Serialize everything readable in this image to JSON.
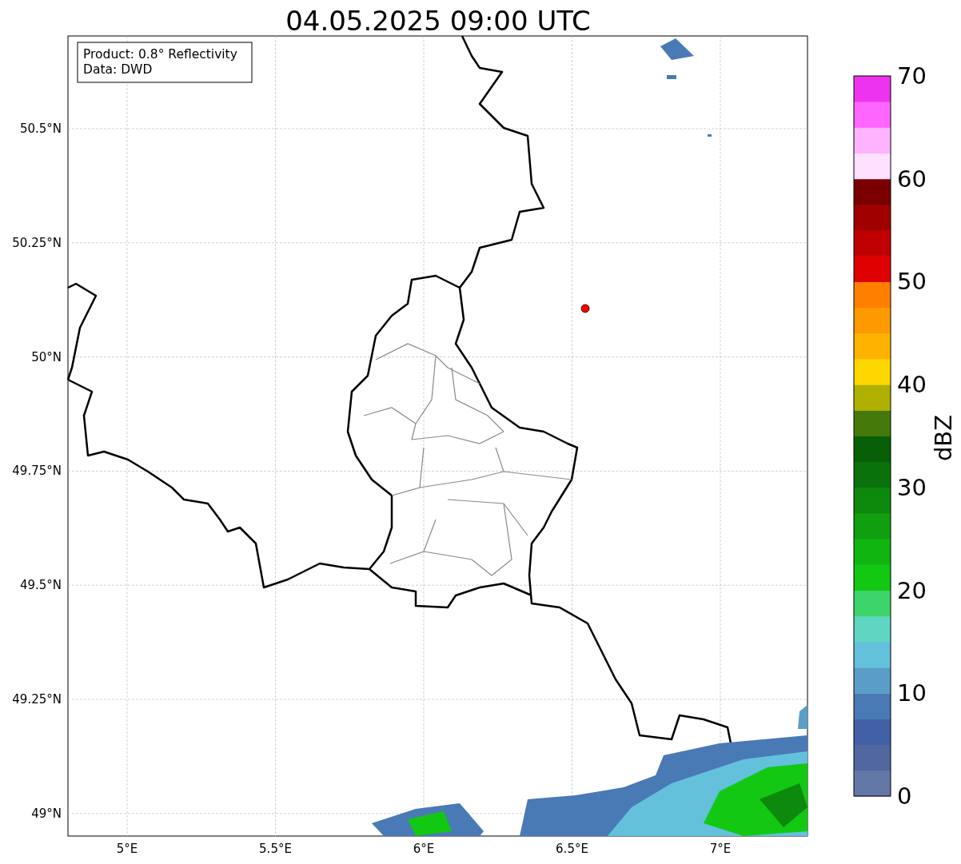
{
  "title": "04.05.2025 09:00 UTC",
  "info_box": [
    "Product: 0.8° Reflectivity",
    "Data: DWD"
  ],
  "x_ticks": [
    "5°E",
    "5.5°E",
    "6°E",
    "6.5°E",
    "7°E"
  ],
  "y_ticks": [
    "50.5°N",
    "50.25°N",
    "50°N",
    "49.75°N",
    "49.5°N",
    "49.25°N",
    "49°N"
  ],
  "colorbar": {
    "label": "dBZ",
    "ticks": [
      "70",
      "60",
      "50",
      "40",
      "30",
      "20",
      "10",
      "0"
    ],
    "segments": [
      {
        "color": "#6478a8"
      },
      {
        "color": "#50689f"
      },
      {
        "color": "#4260a5"
      },
      {
        "color": "#4a7ab5"
      },
      {
        "color": "#5a9ec8"
      },
      {
        "color": "#63c1dc"
      },
      {
        "color": "#5fd6c2"
      },
      {
        "color": "#3dd56b"
      },
      {
        "color": "#12c812"
      },
      {
        "color": "#10b510"
      },
      {
        "color": "#0f9f0f"
      },
      {
        "color": "#0d8a0d"
      },
      {
        "color": "#0a720a"
      },
      {
        "color": "#075f07"
      },
      {
        "color": "#457a0a"
      },
      {
        "color": "#afb000"
      },
      {
        "color": "#ffd700"
      },
      {
        "color": "#ffb300"
      },
      {
        "color": "#ff9900"
      },
      {
        "color": "#ff8000"
      },
      {
        "color": "#e00000"
      },
      {
        "color": "#c00000"
      },
      {
        "color": "#a00000"
      },
      {
        "color": "#7a0000"
      },
      {
        "color": "#ffe0ff"
      },
      {
        "color": "#ffb3ff"
      },
      {
        "color": "#ff66ff"
      },
      {
        "color": "#ee33ee"
      }
    ]
  }
}
